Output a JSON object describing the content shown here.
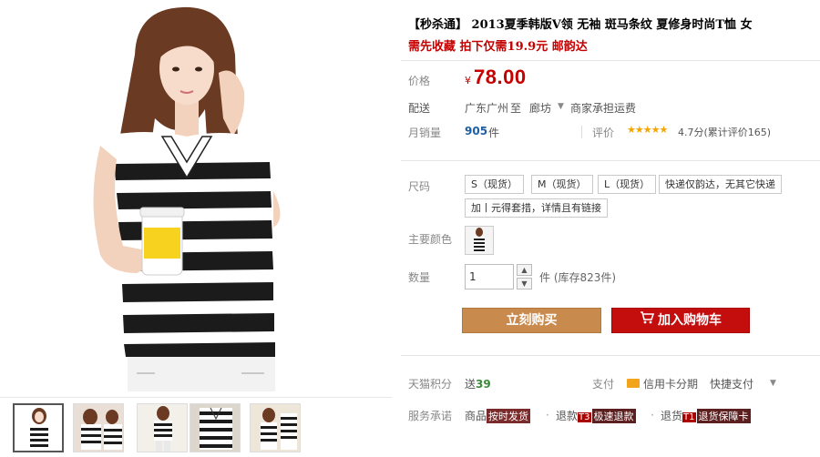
{
  "product": {
    "title": "【秒杀通】 2013夏季韩版V领 无袖 斑马条纹 夏修身时尚T恤 女",
    "subtitle": "需先收藏 拍下仅需19.9元 邮韵达"
  },
  "price": {
    "label": "价格",
    "currency": "¥",
    "value": "78.00"
  },
  "shipping": {
    "label": "配送",
    "from": "广东广州",
    "to_word": "至",
    "destination": "廊坊",
    "fee": "商家承担运费"
  },
  "sales": {
    "label": "月销量",
    "count": "905",
    "unit": "件",
    "rating_label": "评价",
    "stars": "★★★★★",
    "rating_text": "4.7分(累计评价165)"
  },
  "size": {
    "label": "尺码",
    "options": [
      "S（现货）",
      "M（现货）",
      "L（现货）",
      "快递仅韵达，无其它快递",
      "加丨元得套措，详情且有链接"
    ]
  },
  "color": {
    "label": "主要颜色"
  },
  "quantity": {
    "label": "数量",
    "value": "1",
    "up": "▲",
    "down": "▼",
    "stock": "件 (库存823件)"
  },
  "actions": {
    "buy_now": "立刻购买",
    "add_to_cart": "加入购物车"
  },
  "points": {
    "label": "天猫积分",
    "prefix": "送",
    "value": "39"
  },
  "payment": {
    "label": "支付",
    "card": "信用卡分期",
    "fast": "快捷支付",
    "caret": "▼"
  },
  "service": {
    "label": "服务承诺",
    "item1_prefix": "商品",
    "item1_tag": "按时发货",
    "item2_prefix": "退款",
    "item2_badge": "T3",
    "item2_tag": "极速退款",
    "item3_prefix": "退货",
    "item3_badge": "T1",
    "item3_tag": "退货保障卡"
  },
  "icons": {
    "cart": "shopping-cart-icon",
    "card": "credit-card-icon",
    "caret": "chevron-down-icon"
  },
  "colors": {
    "price_red": "#c40000",
    "buy_button": "#c98a4d",
    "cart_button": "#c40e0e",
    "sales_blue": "#1e5fa3",
    "star_gold": "#f5a500"
  }
}
